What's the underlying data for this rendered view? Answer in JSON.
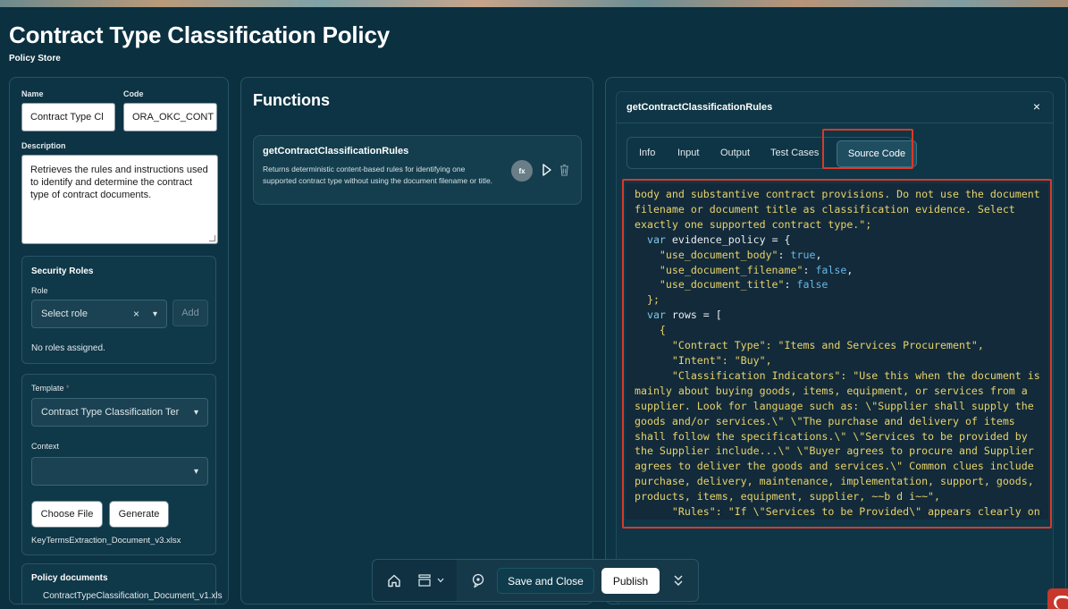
{
  "page": {
    "title": "Contract Type Classification Policy",
    "subtitle": "Policy Store"
  },
  "form": {
    "name_label": "Name",
    "name_value": "Contract Type Cl",
    "code_label": "Code",
    "code_value": "ORA_OKC_CONT",
    "description_label": "Description",
    "description_value": "Retrieves the rules and instructions used to identify and determine the contract type of contract documents."
  },
  "security_roles": {
    "title": "Security Roles",
    "role_label": "Role",
    "role_placeholder": "Select role",
    "add_label": "Add",
    "empty_text": "No roles assigned."
  },
  "template_section": {
    "template_label": "Template",
    "required_mark": "*",
    "template_value": "Contract Type Classification Ter",
    "context_label": "Context",
    "context_value": "",
    "choose_file_label": "Choose File",
    "generate_label": "Generate",
    "file_name": "KeyTermsExtraction_Document_v3.xlsx"
  },
  "policy_documents": {
    "title": "Policy documents",
    "file_name": "ContractTypeClassification_Document_v1.xls"
  },
  "functions": {
    "title": "Functions",
    "items": [
      {
        "name": "getContractClassificationRules",
        "description": "Returns deterministic content-based rules for identifying one supported contract type without using the document filename or title.",
        "fx_label": "fx"
      }
    ]
  },
  "dialog": {
    "title": "getContractClassificationRules",
    "close": "×",
    "tabs": [
      "Info",
      "Input",
      "Output",
      "Test Cases"
    ],
    "active_tab": "Source Code"
  },
  "code": {
    "l1": "body and substantive contract provisions. Do not use the document",
    "l2": "filename or document title as classification evidence. Select",
    "l3": "exactly one supported contract type.\";",
    "l4_kw": "var",
    "l4_name": "evidence_policy",
    "l4_rest": " = {",
    "l5_key": "\"use_document_body\"",
    "l5_val": "true",
    "l6_key": "\"use_document_filename\"",
    "l6_val": "false",
    "l7_key": "\"use_document_title\"",
    "l7_val": "false",
    "l8": "};",
    "l9_kw": "var",
    "l9_name": "rows",
    "l9_rest": " = [",
    "l10": "{",
    "l11": "\"Contract Type\": \"Items and Services Procurement\",",
    "l12": "\"Intent\": \"Buy\",",
    "l13": "\"Classification Indicators\": \"Use this when the document is",
    "l14": "mainly about buying goods, items, equipment, or services from a",
    "l15": "supplier. Look for language such as: \\\"Supplier shall supply the",
    "l16": "goods and/or services.\\\" \\\"The purchase and delivery of items",
    "l17": "shall follow the specifications.\\\" \\\"Services to be provided by",
    "l18": "the Supplier include...\\\" \\\"Buyer agrees to procure and Supplier",
    "l19": "agrees to deliver the goods and services.\\\" Common clues include",
    "l20": "purchase, delivery, maintenance, implementation, support, goods,",
    "l21": "products, items, equipment, supplier, ~~b d i~~\",",
    "l22": "\"Rules\": \"If \\\"Services to be Provided\\\" appears clearly on"
  },
  "toolbar": {
    "save_close_label": "Save and Close",
    "publish_label": "Publish"
  },
  "icons": {
    "home": "home-icon",
    "layers": "layers-icon",
    "assistant": "assistant-icon",
    "expand": "double-chevron-icon",
    "brand": "oracle-logo"
  },
  "colors": {
    "background": "#0b3040",
    "highlight": "#d83a2a",
    "code_string": "#e7d36a",
    "code_boolean": "#69b7e8"
  }
}
